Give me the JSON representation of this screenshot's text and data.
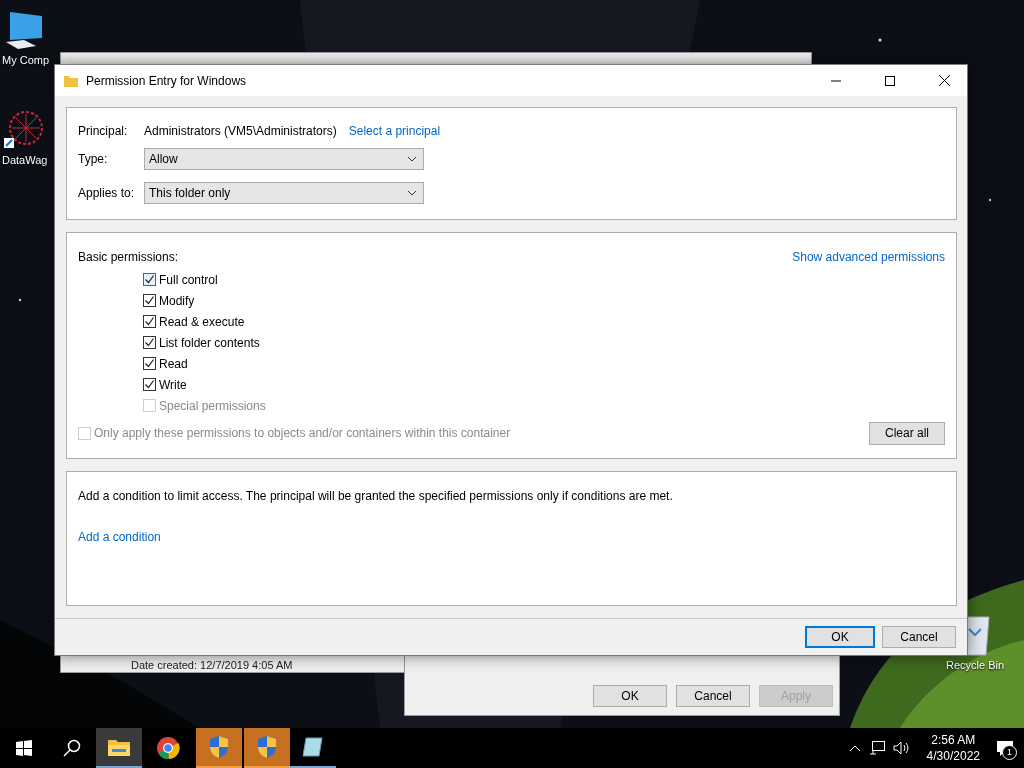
{
  "desktop": {
    "icons": [
      {
        "kind": "computer",
        "label": "My Comp"
      },
      {
        "kind": "shortcut",
        "label": "DataWag"
      },
      {
        "kind": "bin",
        "label": "Recycle Bin"
      }
    ]
  },
  "explorer_window": {
    "status_text": "Date created: 12/7/2019 4:05 AM"
  },
  "properties_window": {
    "buttons": [
      {
        "label": "OK",
        "disabled": false
      },
      {
        "label": "Cancel",
        "disabled": false
      },
      {
        "label": "Apply",
        "disabled": true
      }
    ]
  },
  "dialog": {
    "title": "Permission Entry for Windows",
    "principal": {
      "label": "Principal:",
      "value": "Administrators (VM5\\Administrators)",
      "link": "Select a principal"
    },
    "type": {
      "label": "Type:",
      "value": "Allow"
    },
    "applies_to": {
      "label": "Applies to:",
      "value": "This folder only"
    },
    "permissions": {
      "heading": "Basic permissions:",
      "link": "Show advanced permissions",
      "items": [
        {
          "label": "Full control",
          "checked": true,
          "disabled": false,
          "hover": true
        },
        {
          "label": "Modify",
          "checked": true,
          "disabled": false,
          "hover": false
        },
        {
          "label": "Read & execute",
          "checked": true,
          "disabled": false,
          "hover": false
        },
        {
          "label": "List folder contents",
          "checked": true,
          "disabled": false,
          "hover": false
        },
        {
          "label": "Read",
          "checked": true,
          "disabled": false,
          "hover": false
        },
        {
          "label": "Write",
          "checked": true,
          "disabled": false,
          "hover": false
        },
        {
          "label": "Special permissions",
          "checked": false,
          "disabled": true,
          "hover": false
        }
      ],
      "only_apply": {
        "label": "Only apply these permissions to objects and/or containers within this container",
        "checked": false,
        "disabled": true
      },
      "clear_button": "Clear all"
    },
    "condition": {
      "text": "Add a condition to limit access. The principal will be granted the specified permissions only if conditions are met.",
      "link": "Add a condition"
    },
    "buttons": [
      {
        "label": "OK",
        "default": true
      },
      {
        "label": "Cancel",
        "default": false
      }
    ]
  },
  "taskbar": {
    "apps": [
      {
        "kind": "explorer",
        "active": true,
        "attention": false,
        "running": true
      },
      {
        "kind": "chrome",
        "active": false,
        "attention": false,
        "running": false
      },
      {
        "kind": "shield",
        "active": false,
        "attention": true,
        "running": true
      },
      {
        "kind": "shield",
        "active": false,
        "attention": true,
        "running": true
      },
      {
        "kind": "app",
        "active": false,
        "attention": false,
        "running": true
      }
    ],
    "tray": {
      "time": "2:56 AM",
      "date": "4/30/2022",
      "notifications": "1"
    }
  }
}
